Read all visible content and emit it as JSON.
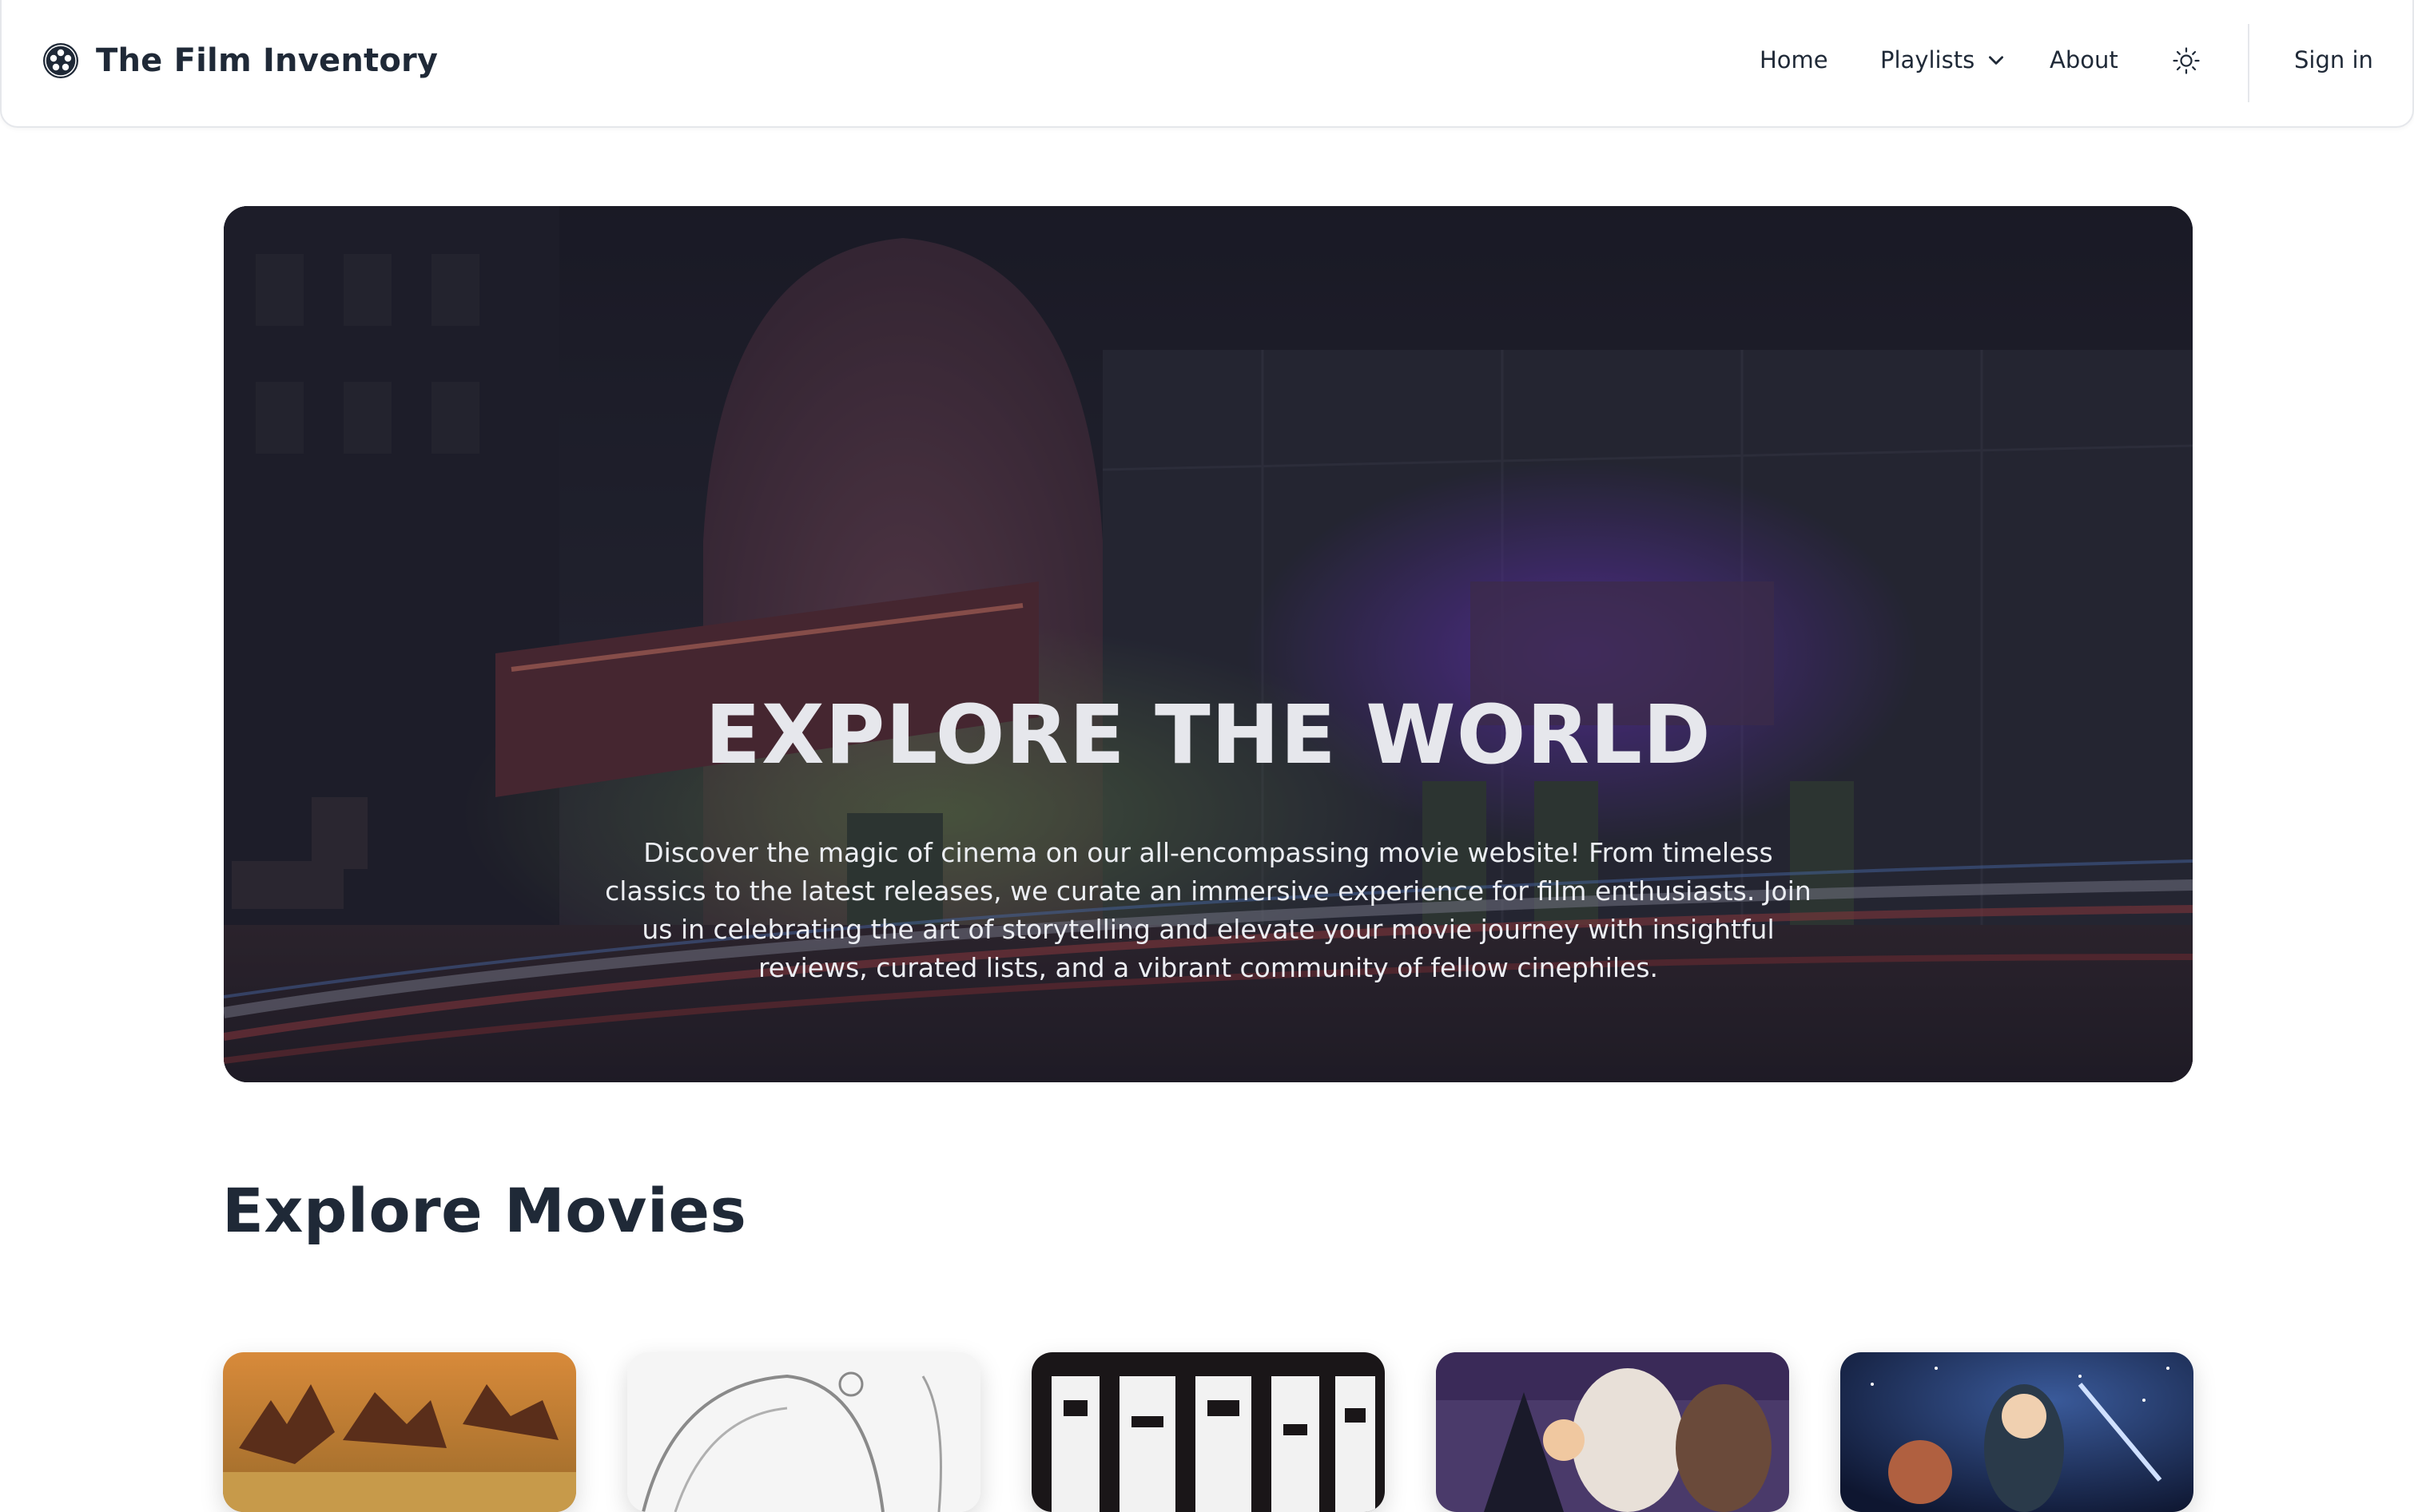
{
  "navbar": {
    "brand_name": "The Film Inventory",
    "brand_icon": "film-reel-icon",
    "items": [
      {
        "label": "Home"
      },
      {
        "label": "Playlists",
        "icon": "chevron-down-icon"
      },
      {
        "label": "About"
      }
    ],
    "theme_icon": "sun-icon",
    "signin_label": "Sign in"
  },
  "hero": {
    "title": "EXPLORE THE WORLD",
    "description": "Discover the magic of cinema on our all-encompassing movie website! From timeless classics to the latest releases, we curate an immersive experience for film enthusiasts. Join us in celebrating the art of storytelling and elevate your movie journey with insightful reviews, curated lists, and a vibrant community of fellow cinephiles.",
    "background": "cinema-street-at-night-image"
  },
  "movies_section": {
    "title": "Explore Movies",
    "posters": [
      {
        "image": "poster-1"
      },
      {
        "image": "poster-2"
      },
      {
        "image": "poster-3"
      },
      {
        "image": "poster-4"
      },
      {
        "image": "poster-5"
      }
    ]
  },
  "colors": {
    "text_primary": "#1f2937",
    "border": "#e5e7eb",
    "hero_overlay": "#181a28"
  }
}
